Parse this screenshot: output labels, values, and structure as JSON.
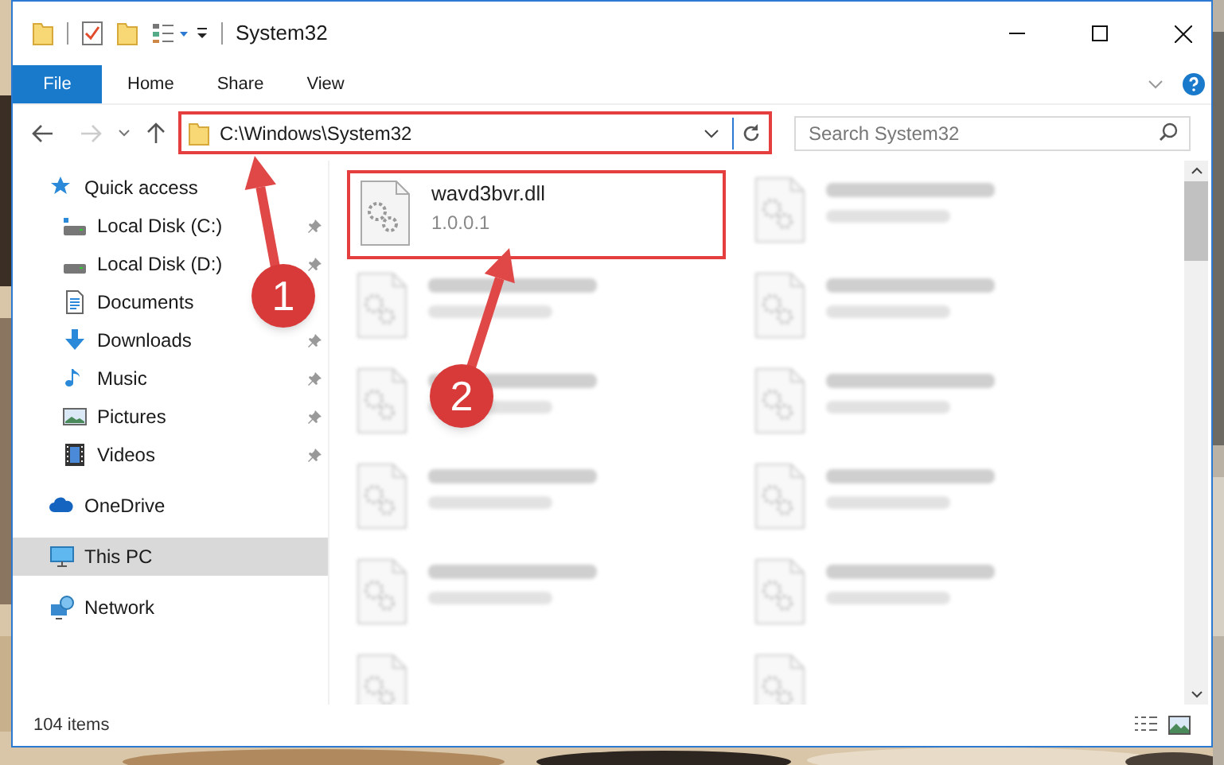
{
  "window": {
    "title": "System32"
  },
  "file_button": {
    "label": "File"
  },
  "ribbon_tabs": [
    {
      "label": "Home"
    },
    {
      "label": "Share"
    },
    {
      "label": "View"
    }
  ],
  "address_bar": {
    "path": "C:\\Windows\\System32",
    "highlighted": true
  },
  "search": {
    "placeholder": "Search System32"
  },
  "navigation": [
    {
      "label": "Quick access",
      "kind": "star",
      "selected": false,
      "children": [
        {
          "label": "Local Disk (C:)",
          "kind": "drive_c",
          "pinned": true,
          "selected": false
        },
        {
          "label": "Local Disk (D:)",
          "kind": "drive",
          "pinned": true,
          "selected": false
        },
        {
          "label": "Documents",
          "kind": "documents",
          "pinned": false,
          "selected": false
        },
        {
          "label": "Downloads",
          "kind": "downloads",
          "pinned": true,
          "selected": false
        },
        {
          "label": "Music",
          "kind": "music",
          "pinned": true,
          "selected": false
        },
        {
          "label": "Pictures",
          "kind": "pictures",
          "pinned": true,
          "selected": false
        },
        {
          "label": "Videos",
          "kind": "videos",
          "pinned": true,
          "selected": false
        }
      ]
    },
    {
      "label": "OneDrive",
      "kind": "cloud",
      "selected": false
    },
    {
      "label": "This PC",
      "kind": "pc",
      "selected": true
    },
    {
      "label": "Network",
      "kind": "network",
      "selected": false
    }
  ],
  "files": [
    {
      "kind": "file",
      "name": "wavd3bvr.dll",
      "detail": "1.0.0.1",
      "highlighted": true
    },
    {
      "kind": "blurred"
    },
    {
      "kind": "blurred"
    },
    {
      "kind": "blurred"
    },
    {
      "kind": "blurred"
    },
    {
      "kind": "blurred"
    },
    {
      "kind": "blurred"
    },
    {
      "kind": "blurred"
    },
    {
      "kind": "blurred"
    },
    {
      "kind": "blurred"
    },
    {
      "kind": "partial"
    },
    {
      "kind": "partial"
    }
  ],
  "status_bar": {
    "item_count": "104 items"
  },
  "annotations": [
    {
      "number": "1"
    },
    {
      "number": "2"
    }
  ]
}
